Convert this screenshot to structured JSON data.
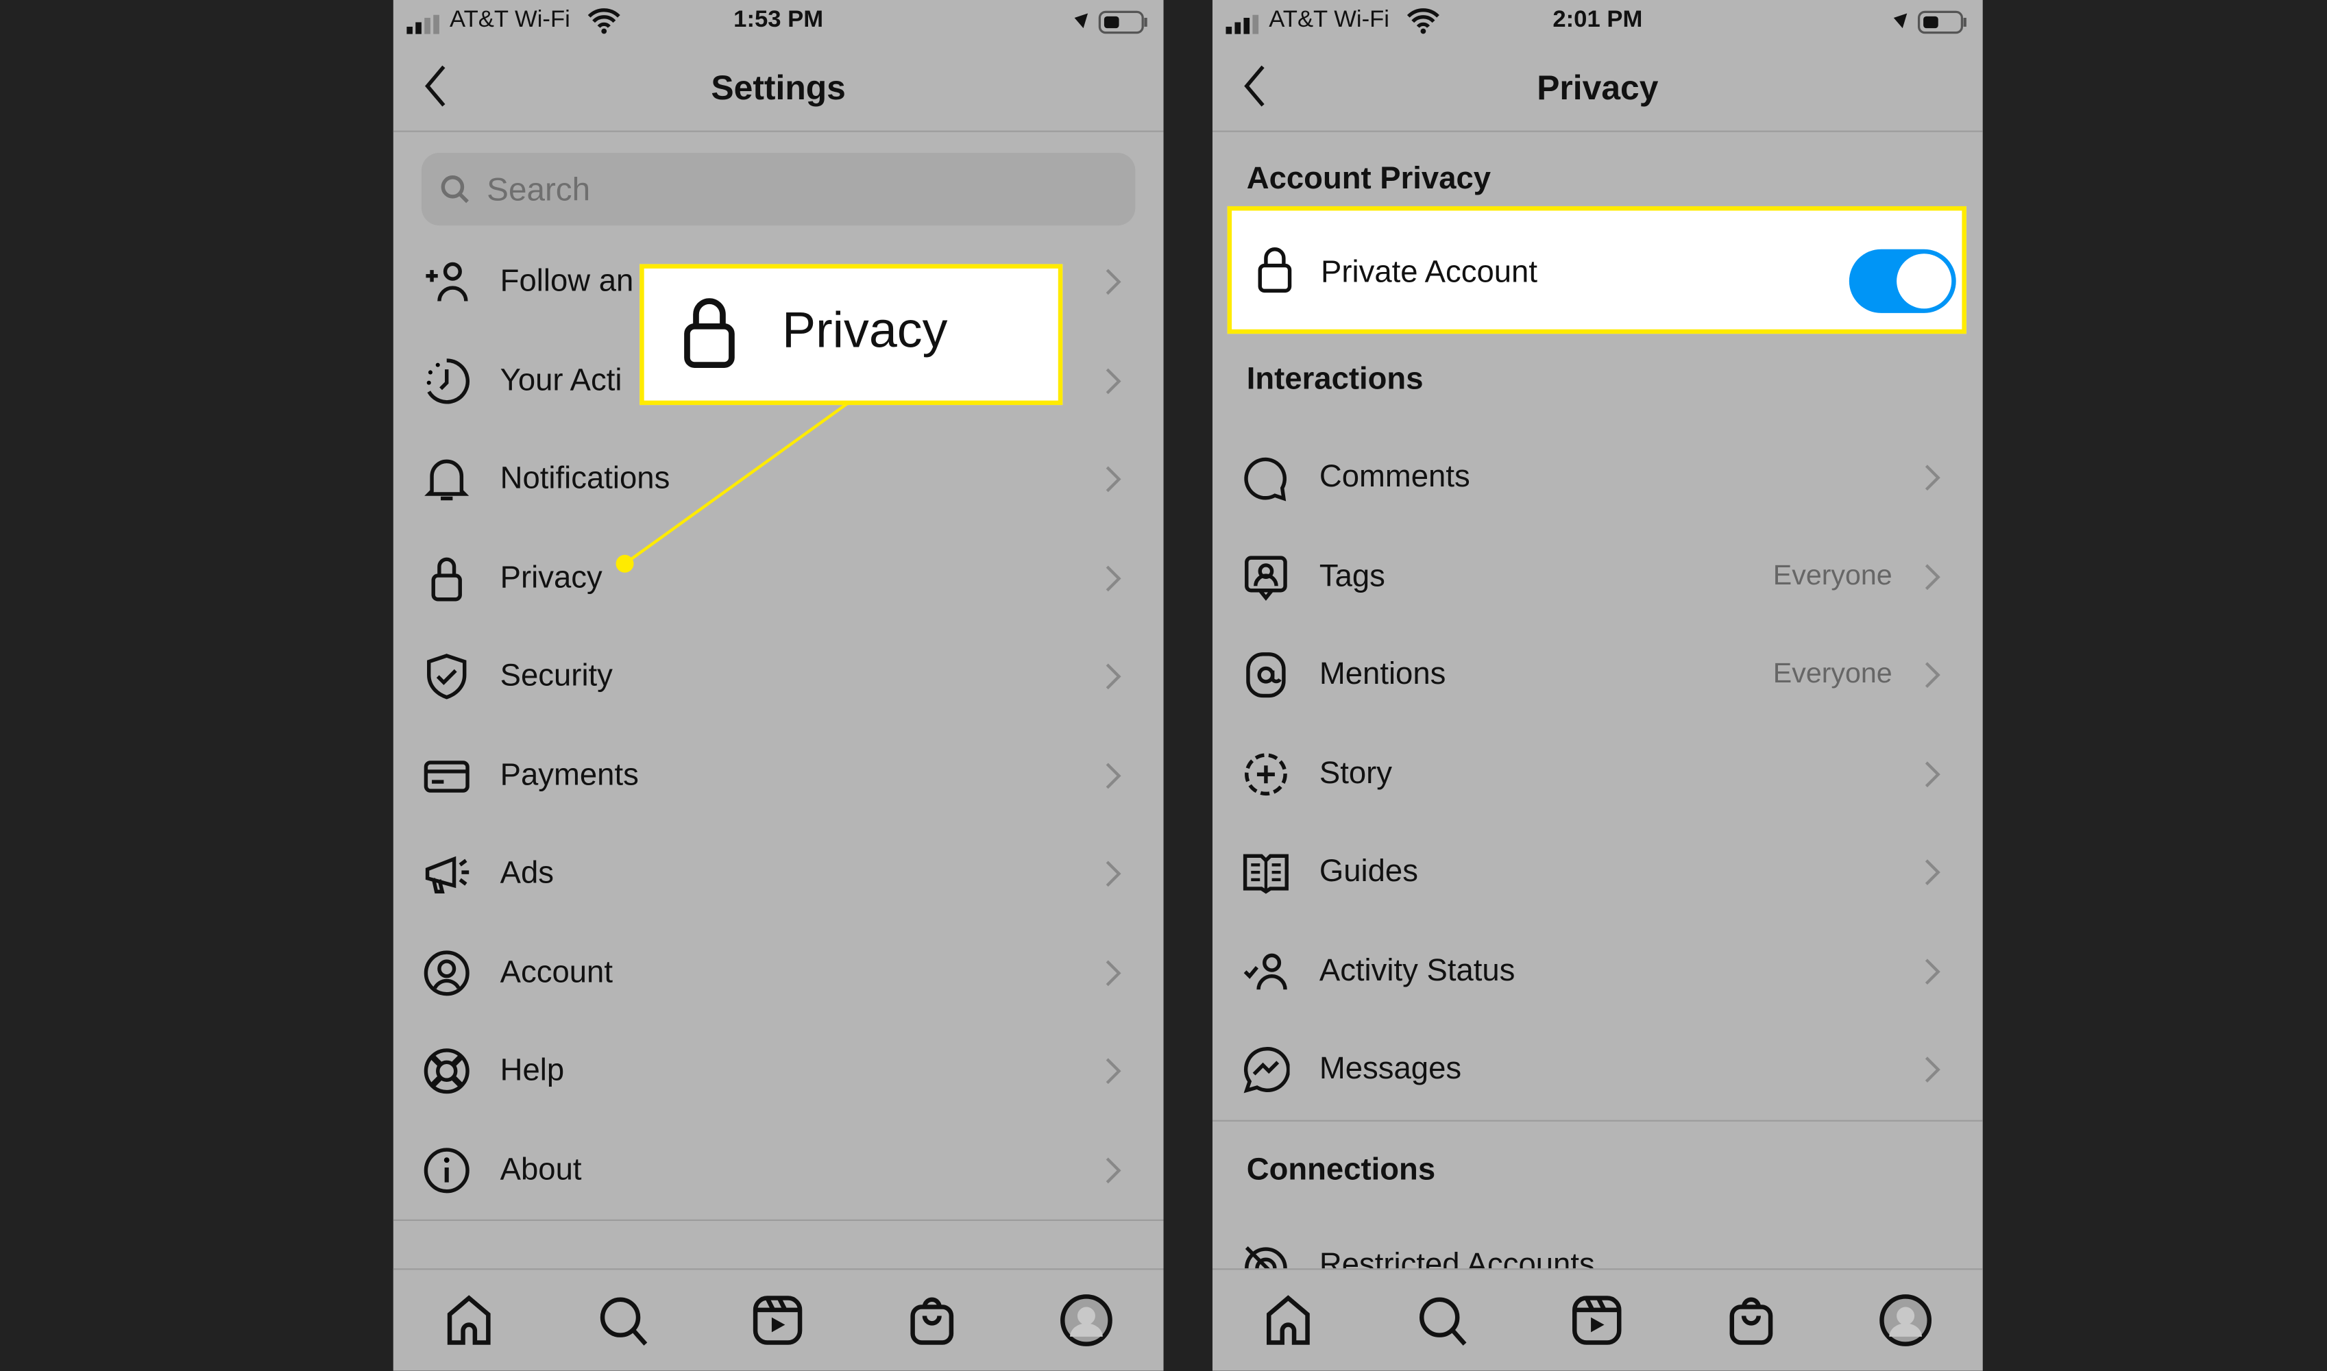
{
  "left": {
    "status": {
      "carrier": "AT&T Wi-Fi",
      "time": "1:53 PM"
    },
    "title": "Settings",
    "search_placeholder": "Search",
    "items": [
      {
        "label": "Follow an",
        "icon": "add-person-icon"
      },
      {
        "label": "Your Acti",
        "icon": "activity-clock-icon"
      },
      {
        "label": "Notifications",
        "icon": "bell-icon"
      },
      {
        "label": "Privacy",
        "icon": "lock-icon"
      },
      {
        "label": "Security",
        "icon": "shield-icon"
      },
      {
        "label": "Payments",
        "icon": "credit-card-icon"
      },
      {
        "label": "Ads",
        "icon": "megaphone-icon"
      },
      {
        "label": "Account",
        "icon": "account-circle-icon"
      },
      {
        "label": "Help",
        "icon": "lifebuoy-icon"
      },
      {
        "label": "About",
        "icon": "info-icon"
      }
    ],
    "callout": {
      "label": "Privacy"
    }
  },
  "right": {
    "status": {
      "carrier": "AT&T Wi-Fi",
      "time": "2:01 PM"
    },
    "title": "Privacy",
    "account_privacy": {
      "heading": "Account Privacy",
      "label": "Private Account",
      "enabled": true
    },
    "interactions_heading": "Interactions",
    "items": [
      {
        "label": "Comments",
        "value": "",
        "icon": "comment-icon"
      },
      {
        "label": "Tags",
        "value": "Everyone",
        "icon": "tag-person-icon"
      },
      {
        "label": "Mentions",
        "value": "Everyone",
        "icon": "at-icon"
      },
      {
        "label": "Story",
        "value": "",
        "icon": "story-plus-icon"
      },
      {
        "label": "Guides",
        "value": "",
        "icon": "guide-book-icon"
      },
      {
        "label": "Activity Status",
        "value": "",
        "icon": "activity-status-icon"
      },
      {
        "label": "Messages",
        "value": "",
        "icon": "messenger-icon"
      }
    ],
    "connections_heading": "Connections",
    "restricted": "Restricted Accounts"
  },
  "tabs": [
    "home-icon",
    "search-icon",
    "reels-icon",
    "shop-icon",
    "profile-icon"
  ],
  "colors": {
    "highlight": "#ffeb00",
    "toggle": "#0095f6",
    "phone_bg": "#b5b5b5",
    "page_bg": "#222222"
  }
}
